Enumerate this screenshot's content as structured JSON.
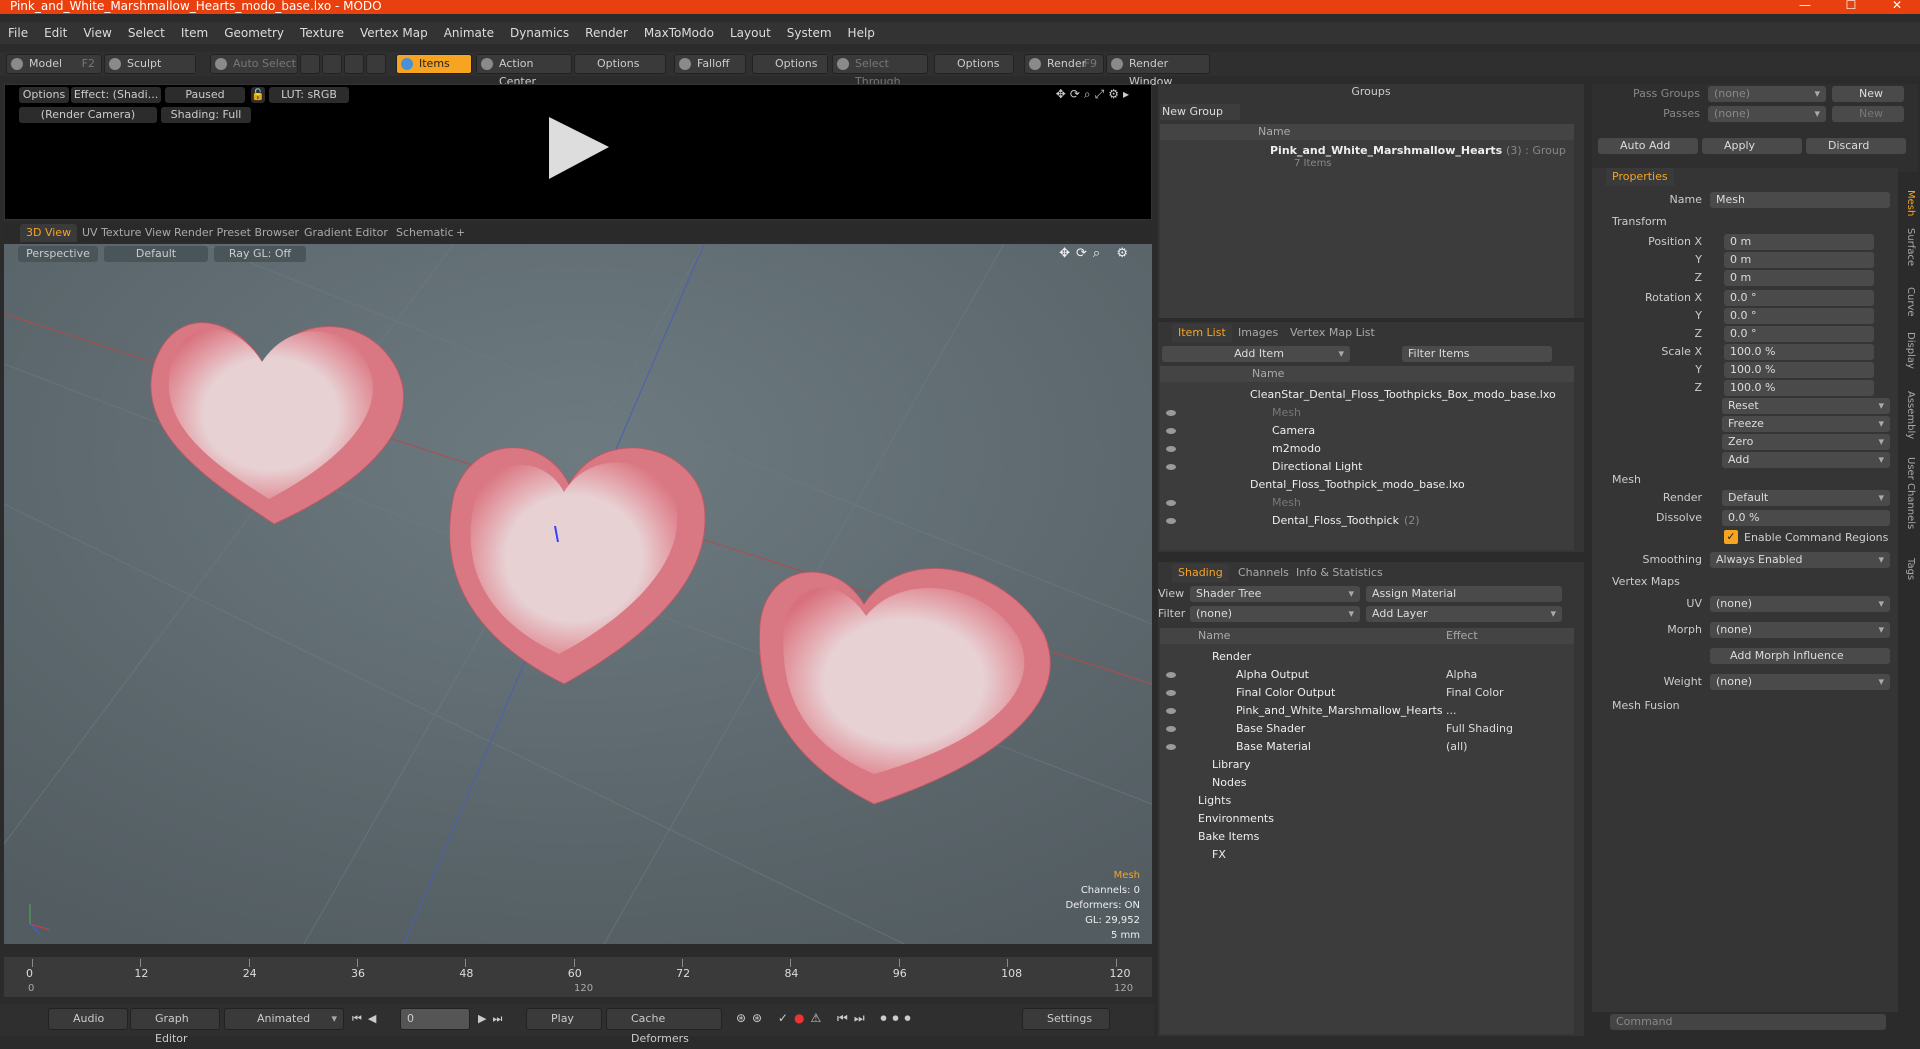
{
  "window": {
    "title": "Pink_and_White_Marshmallow_Hearts_modo_base.lxo - MODO"
  },
  "menu": [
    "File",
    "Edit",
    "View",
    "Select",
    "Item",
    "Geometry",
    "Texture",
    "Vertex Map",
    "Animate",
    "Dynamics",
    "Render",
    "MaxToModo",
    "Layout",
    "System",
    "Help"
  ],
  "toolbar": {
    "model": "Model",
    "model_key": "F2",
    "sculpt": "Sculpt",
    "auto_select": "Auto Select",
    "items": "Items",
    "action_center": "Action Center",
    "options1": "Options",
    "falloff": "Falloff",
    "options2": "Options",
    "select_through": "Select Through",
    "options3": "Options",
    "render": "Render",
    "render_key": "F9",
    "render_window": "Render Window"
  },
  "preview": {
    "options": "Options",
    "effect": "Effect: (Shadi...",
    "paused": "Paused",
    "lut": "LUT: sRGB",
    "camera": "(Render Camera)",
    "shading": "Shading: Full"
  },
  "view_tabs": [
    "3D View",
    "UV Texture View",
    "Render Preset Browser",
    "Gradient Editor",
    "Schematic"
  ],
  "viewport": {
    "perspective": "Perspective",
    "default": "Default",
    "raygl": "Ray GL: Off",
    "info": {
      "mesh": "Mesh",
      "channels": "Channels: 0",
      "deformers": "Deformers: ON",
      "gl": "GL: 29,952",
      "units": "5 mm"
    }
  },
  "timeline": {
    "ticks": [
      "0",
      "12",
      "24",
      "36",
      "48",
      "60",
      "72",
      "84",
      "96",
      "108",
      "120"
    ],
    "sub_ticks": [
      "0",
      "120",
      "120"
    ]
  },
  "bottom": {
    "audio": "Audio",
    "graph_editor": "Graph Editor",
    "animated": "Animated",
    "frame": "0",
    "play": "Play",
    "cache": "Cache Deformers",
    "settings": "Settings"
  },
  "groups": {
    "title": "Groups",
    "new_group": "New Group",
    "col_name": "Name",
    "row_name": "Pink_and_White_Marshmallow_Hearts",
    "row_count": "(3) : Group",
    "row_sub": "7 Items"
  },
  "itemlist": {
    "tabs": [
      "Item List",
      "Images",
      "Vertex Map List"
    ],
    "add_item": "Add Item",
    "filter": "Filter Items",
    "col_name": "Name",
    "rows": [
      {
        "label": "CleanStar_Dental_Floss_Toothpicks_Box_modo_base.lxo",
        "dim": false
      },
      {
        "label": "Mesh",
        "dim": true
      },
      {
        "label": "Camera",
        "dim": false
      },
      {
        "label": "m2modo",
        "dim": false
      },
      {
        "label": "Directional Light",
        "dim": false
      },
      {
        "label": "Dental_Floss_Toothpick_modo_base.lxo",
        "dim": false
      },
      {
        "label": "Mesh",
        "dim": true
      },
      {
        "label": "Dental_Floss_Toothpick",
        "dim": false,
        "count": "(2)"
      }
    ]
  },
  "shading": {
    "tabs": [
      "Shading",
      "Channels",
      "Info & Statistics"
    ],
    "view_label": "View",
    "view_value": "Shader Tree",
    "assign": "Assign Material",
    "filter_label": "Filter",
    "filter_value": "(none)",
    "add_layer": "Add Layer",
    "col_name": "Name",
    "col_effect": "Effect",
    "rows": [
      {
        "name": "Render",
        "effect": ""
      },
      {
        "name": "Alpha Output",
        "effect": "Alpha"
      },
      {
        "name": "Final Color Output",
        "effect": "Final Color"
      },
      {
        "name": "Pink_and_White_Marshmallow_Hearts",
        "effect": "..."
      },
      {
        "name": "Base Shader",
        "effect": "Full Shading"
      },
      {
        "name": "Base Material",
        "effect": "(all)"
      },
      {
        "name": "Library",
        "effect": ""
      },
      {
        "name": "Nodes",
        "effect": ""
      },
      {
        "name": "Lights",
        "effect": ""
      },
      {
        "name": "Environments",
        "effect": ""
      },
      {
        "name": "Bake Items",
        "effect": ""
      },
      {
        "name": "FX",
        "effect": ""
      }
    ]
  },
  "passes": {
    "pass_groups": "Pass Groups",
    "passes": "Passes",
    "none": "(none)",
    "new": "New",
    "auto_add": "Auto Add",
    "apply": "Apply",
    "discard": "Discard"
  },
  "properties": {
    "title": "Properties",
    "name_label": "Name",
    "name_value": "Mesh",
    "transform": "Transform",
    "pos_label": "Position X",
    "pos": [
      "0 m",
      "0 m",
      "0 m"
    ],
    "rot_label": "Rotation X",
    "rot": [
      "0.0 °",
      "0.0 °",
      "0.0 °"
    ],
    "scale_label": "Scale X",
    "scale": [
      "100.0 %",
      "100.0 %",
      "100.0 %"
    ],
    "y": "Y",
    "z": "Z",
    "reset": "Reset",
    "freeze": "Freeze",
    "zero": "Zero",
    "add": "Add",
    "mesh": "Mesh",
    "render_label": "Render",
    "render_value": "Default",
    "dissolve_label": "Dissolve",
    "dissolve_value": "0.0 %",
    "enable_cmd": "Enable Command Regions",
    "smoothing_label": "Smoothing",
    "smoothing_value": "Always Enabled",
    "vertex_maps": "Vertex Maps",
    "uv_label": "UV",
    "uv_value": "(none)",
    "morph_label": "Morph",
    "morph_value": "(none)",
    "add_morph": "Add Morph Influence",
    "weight_label": "Weight",
    "weight_value": "(none)",
    "mesh_fusion": "Mesh Fusion"
  },
  "vertical_tabs": [
    "Mesh",
    "Surface",
    "Curve",
    "Display",
    "Assembly",
    "User Channels",
    "Tags"
  ],
  "command": {
    "placeholder": "Command"
  }
}
